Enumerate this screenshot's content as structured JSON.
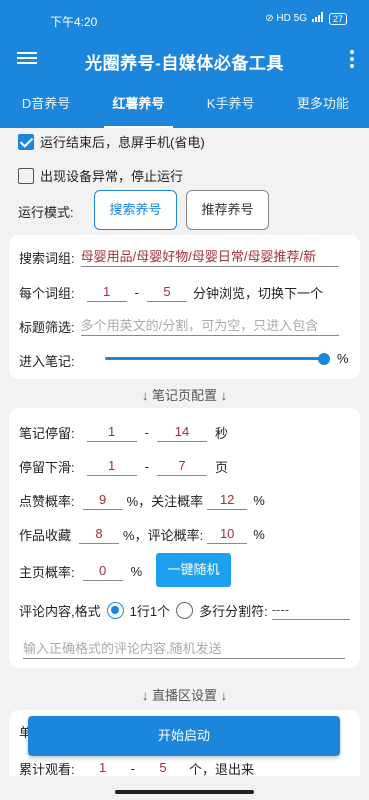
{
  "status": {
    "time": "下午4:20",
    "icons_text": "⊘ HD 5G",
    "battery": "27"
  },
  "app": {
    "title": "光圈养号-自媒体必备工具"
  },
  "tabs": [
    "D音养号",
    "红薯养号",
    "K手养号",
    "更多功能"
  ],
  "active_tab": 1,
  "options": {
    "screen_off_label": "运行结束后，息屏手机(省电)",
    "screen_off_checked": true,
    "stop_on_error_label": "出现设备异常，停止运行",
    "stop_on_error_checked": false
  },
  "mode": {
    "label": "运行模式:",
    "search_label": "搜索养号",
    "recommend_label": "推荐养号",
    "selected": "search"
  },
  "search_card": {
    "keywords_label": "搜索词组:",
    "keywords_value": "母婴用品/母婴好物/母婴日常/母婴推荐/新",
    "per_group_label": "每个词组:",
    "per_group_min": "1",
    "per_group_max": "5",
    "per_group_suffix": "分钟浏览，切换下一个",
    "title_filter_label": "标题筛选:",
    "title_filter_placeholder": "多个用英文的/分割，可为空，只进入包含",
    "enter_note_label": "进入笔记:",
    "enter_note_percent": 100,
    "percent_sign": "%"
  },
  "note_section_label": "↓ 笔记页配置 ↓",
  "note_card": {
    "stay_label": "笔记停留:",
    "stay_min": "1",
    "stay_max": "14",
    "stay_unit": "秒",
    "scroll_label": "停留下滑:",
    "scroll_min": "1",
    "scroll_max": "7",
    "scroll_unit": "页",
    "like_label": "点赞概率:",
    "like_value": "9",
    "follow_label": "%，关注概率",
    "follow_value": "12",
    "collect_label": "作品收藏",
    "collect_value": "8",
    "comment_label": "%，评论概率:",
    "comment_value": "10",
    "home_label": "主页概率:",
    "home_value": "0",
    "percent_sign": "%",
    "random_button": "一键随机",
    "comment_format_label": "评论内容,格式",
    "format_single": "1行1个",
    "format_multi": "多行分割符:",
    "separator_value": "----",
    "comment_placeholder": "输入正确格式的评论内容,随机发送"
  },
  "live_section_label": "↓ 直播区设置 ↓",
  "live_card": {
    "partial_label": "单",
    "total_watch_label": "累计观看:",
    "total_min": "1",
    "total_max": "5",
    "total_suffix": "个，退出来"
  },
  "start_button": "开始启动",
  "colors": {
    "primary": "#1b86dc",
    "input_text": "#a0303a",
    "button_light": "#1ea0f0"
  }
}
